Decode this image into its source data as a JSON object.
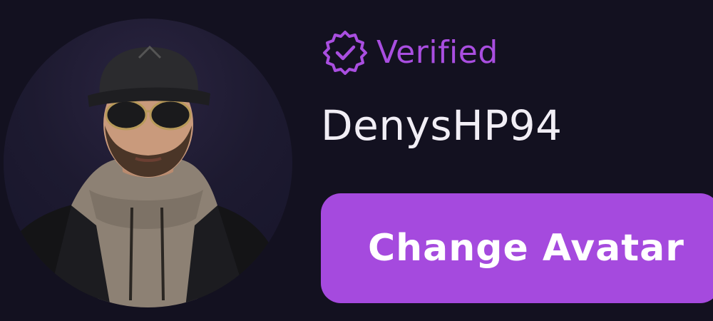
{
  "profile": {
    "verified_label": "Verified",
    "username": "DenysHP94",
    "change_avatar_label": "Change Avatar",
    "avatar_icon": "avatar-photo",
    "verified_icon": "verified-badge-icon"
  },
  "colors": {
    "background": "#131120",
    "accent": "#a54ade",
    "verified_text": "#a94ee0",
    "username_text": "#f1eef5",
    "button_text": "#ffffff"
  }
}
